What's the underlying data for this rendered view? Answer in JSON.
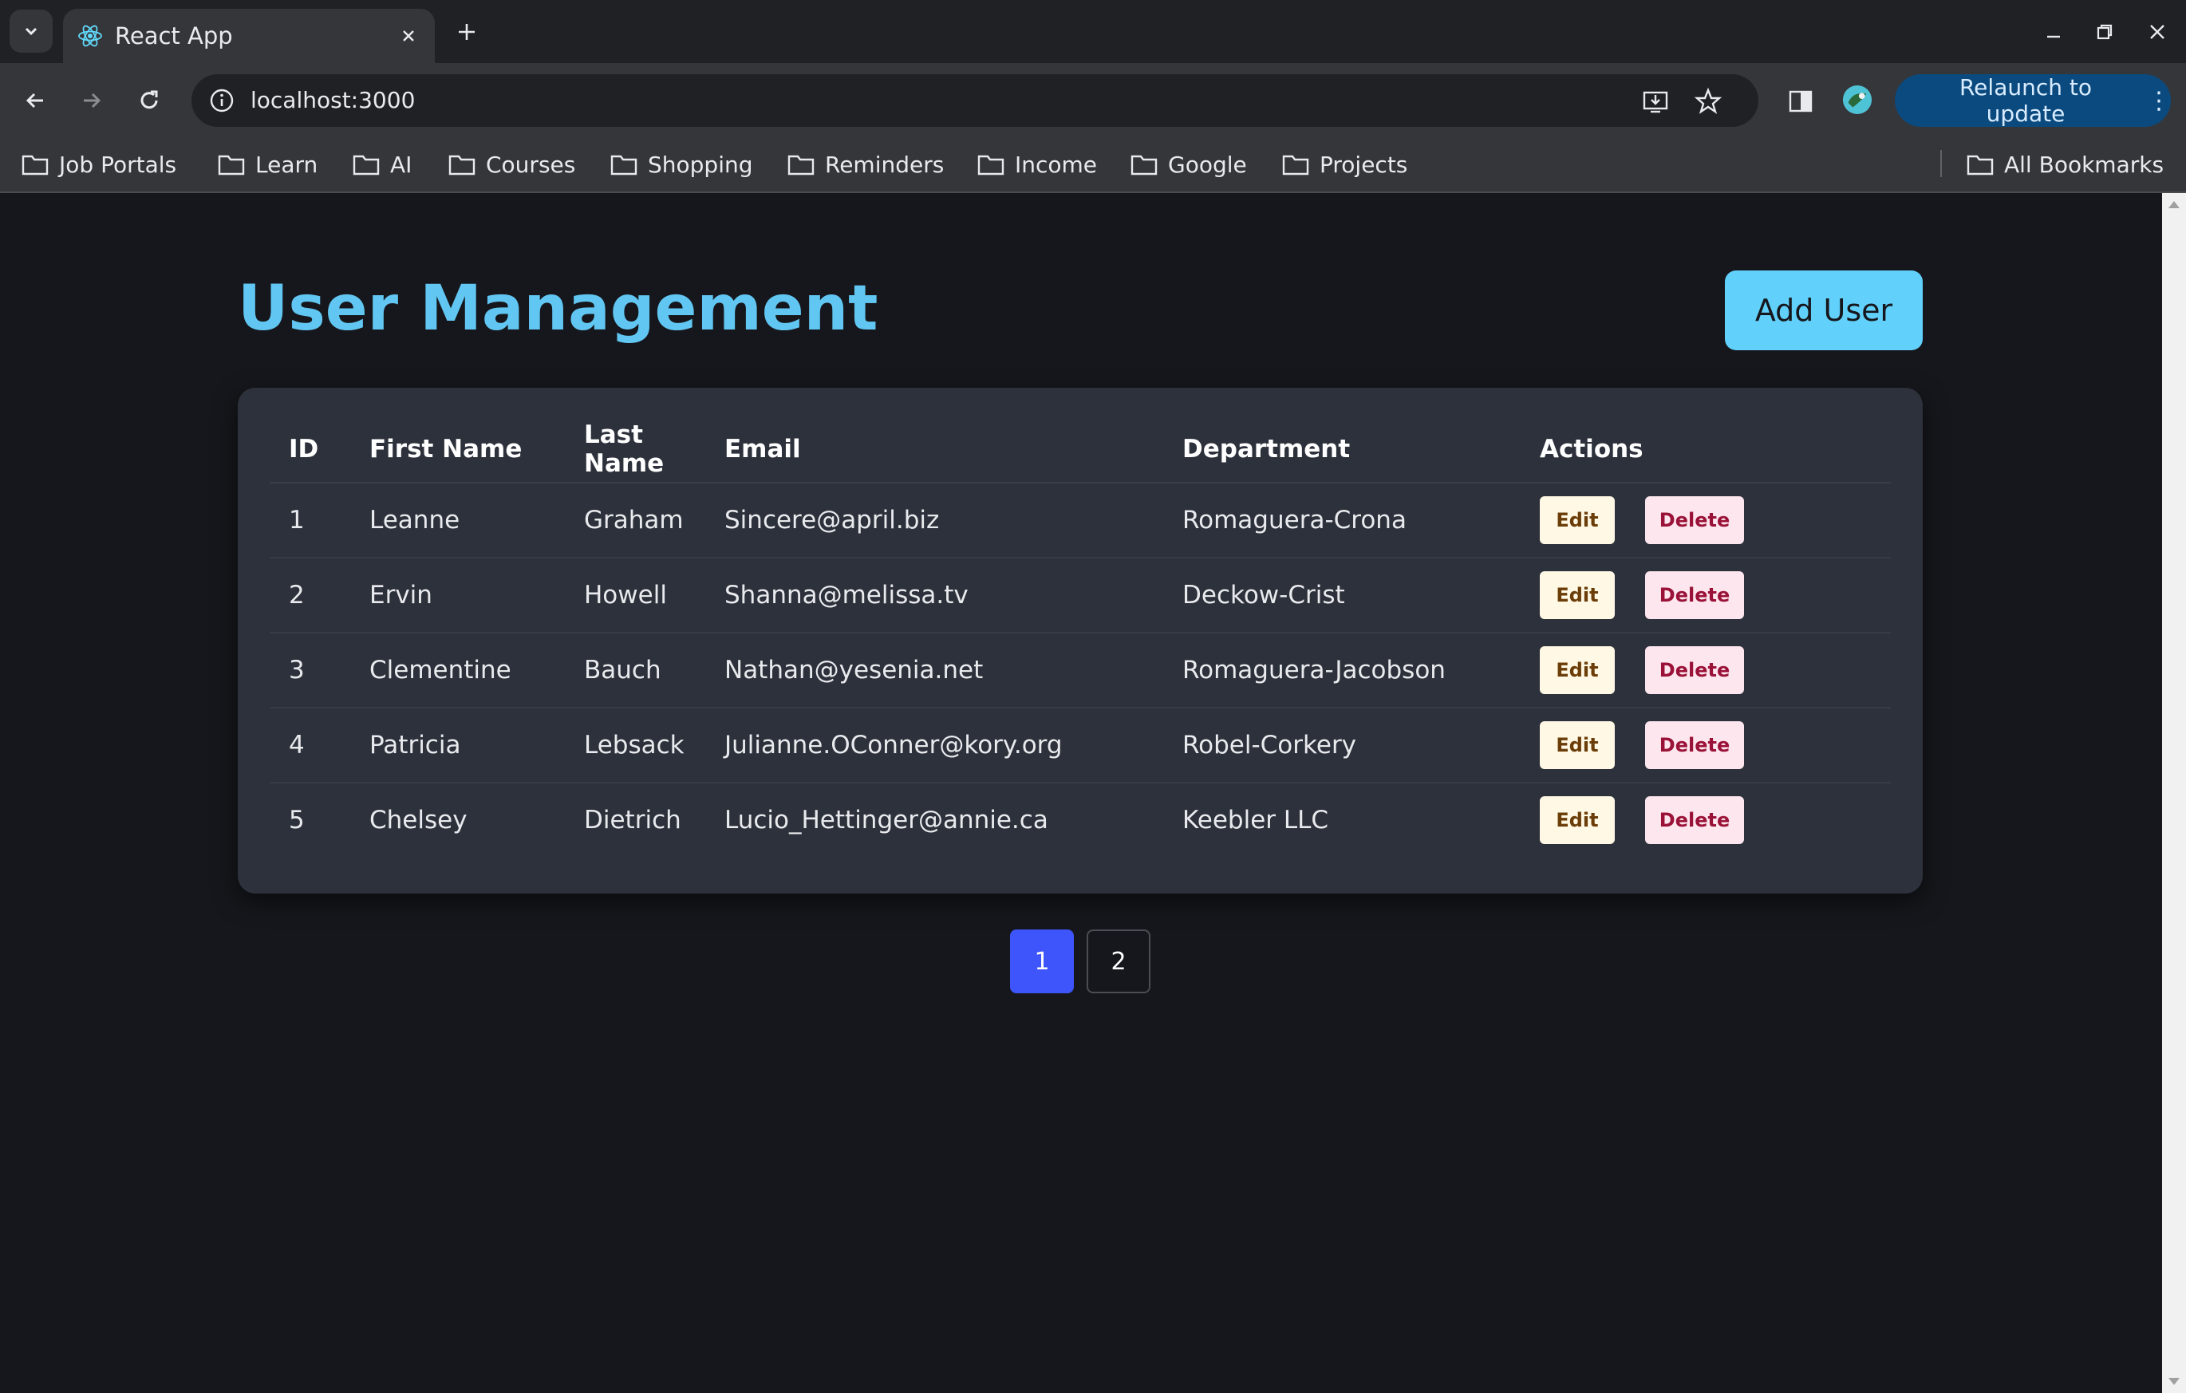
{
  "browser": {
    "tab_title": "React App",
    "url": "localhost:3000",
    "relaunch_label": "Relaunch to update",
    "bookmarks": [
      "Job Portals",
      "Learn",
      "AI",
      "Courses",
      "Shopping",
      "Reminders",
      "Income",
      "Google",
      "Projects"
    ],
    "all_bookmarks": "All Bookmarks"
  },
  "page": {
    "title": "User Management",
    "add_user_label": "Add User"
  },
  "table": {
    "headers": [
      "ID",
      "First Name",
      "Last Name",
      "Email",
      "Department",
      "Actions"
    ],
    "edit_label": "Edit",
    "delete_label": "Delete",
    "rows": [
      {
        "id": "1",
        "first": "Leanne",
        "last": "Graham",
        "email": "Sincere@april.biz",
        "department": "Romaguera-Crona"
      },
      {
        "id": "2",
        "first": "Ervin",
        "last": "Howell",
        "email": "Shanna@melissa.tv",
        "department": "Deckow-Crist"
      },
      {
        "id": "3",
        "first": "Clementine",
        "last": "Bauch",
        "email": "Nathan@yesenia.net",
        "department": "Romaguera-Jacobson"
      },
      {
        "id": "4",
        "first": "Patricia",
        "last": "Lebsack",
        "email": "Julianne.OConner@kory.org",
        "department": "Robel-Corkery"
      },
      {
        "id": "5",
        "first": "Chelsey",
        "last": "Dietrich",
        "email": "Lucio_Hettinger@annie.ca",
        "department": "Keebler LLC"
      }
    ]
  },
  "pagination": {
    "pages": [
      "1",
      "2"
    ],
    "current": "1"
  },
  "colors": {
    "title": "#61c6f2",
    "add_user_bg": "#61d1fb",
    "active_page": "#3d55fa",
    "card_bg": "#2d313b",
    "page_bg": "#16171c"
  }
}
